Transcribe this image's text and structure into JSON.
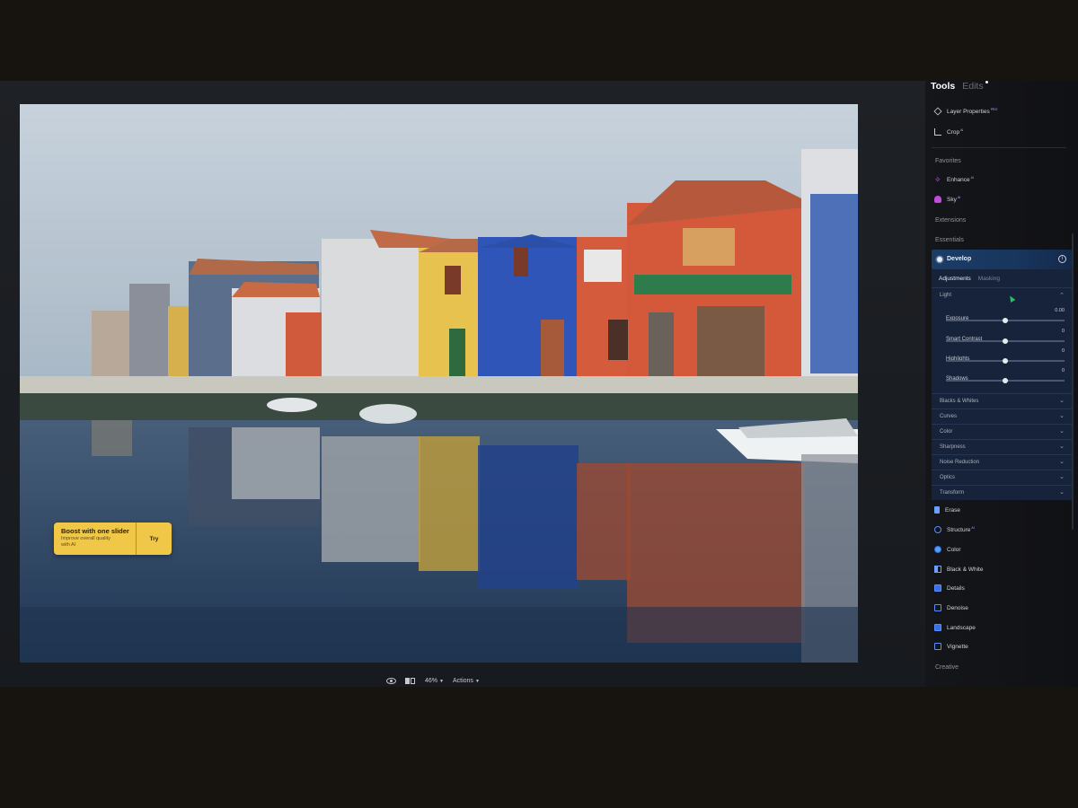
{
  "panel": {
    "tabs": {
      "tools": "Tools",
      "edits": "Edits"
    },
    "top_tools": [
      {
        "label": "Layer Properties",
        "badge": "PRO",
        "icon": "layers-icon"
      },
      {
        "label": "Crop",
        "badge": "AI",
        "icon": "crop-icon"
      }
    ],
    "sections": {
      "favorites": "Favorites",
      "extensions": "Extensions",
      "essentials": "Essentials",
      "creative": "Creative"
    },
    "favorites": [
      {
        "label": "Enhance",
        "badge": "AI",
        "icon": "enhance-icon"
      },
      {
        "label": "Sky",
        "badge": "AI",
        "icon": "sky-icon"
      }
    ],
    "develop": {
      "title": "Develop",
      "subtabs": {
        "adjustments": "Adjustments",
        "masking": "Masking"
      },
      "light_label": "Light",
      "sliders": [
        {
          "name": "Exposure",
          "value": "0.00",
          "level": 0.5
        },
        {
          "name": "Smart Contrast",
          "value": "0",
          "level": 0.5
        },
        {
          "name": "Highlights",
          "value": "0",
          "level": 0.5
        },
        {
          "name": "Shadows",
          "value": "0",
          "level": 0.5
        }
      ],
      "groups": [
        "Blacks & Whites",
        "Curves",
        "Color",
        "Sharpness",
        "Noise Reduction",
        "Optics",
        "Transform"
      ]
    },
    "essentials": [
      {
        "label": "Erase",
        "badge": "",
        "icon": "erase-icon"
      },
      {
        "label": "Structure",
        "badge": "AI",
        "icon": "structure-icon"
      },
      {
        "label": "Color",
        "badge": "",
        "icon": "color-icon"
      },
      {
        "label": "Black & White",
        "badge": "",
        "icon": "black-white-icon"
      },
      {
        "label": "Details",
        "badge": "",
        "icon": "details-icon"
      },
      {
        "label": "Denoise",
        "badge": "",
        "icon": "denoise-icon"
      },
      {
        "label": "Landscape",
        "badge": "",
        "icon": "landscape-icon"
      },
      {
        "label": "Vignette",
        "badge": "",
        "icon": "vignette-icon"
      }
    ]
  },
  "boost": {
    "title": "Boost with one slider",
    "subtitle_1": "Improve overall quality",
    "subtitle_2": "with AI",
    "cta": "Try"
  },
  "bottom_bar": {
    "zoom": "46%",
    "actions": "Actions"
  },
  "colors": {
    "accent": "#1a3d66",
    "boost": "#f1c748",
    "ai_badge": "#b9a7ff"
  }
}
